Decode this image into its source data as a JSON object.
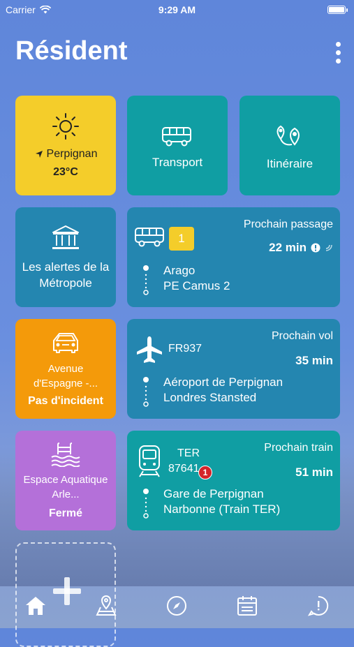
{
  "statusbar": {
    "carrier": "Carrier",
    "time": "9:29 AM"
  },
  "header": {
    "title": "Résident"
  },
  "weather": {
    "city": "Perpignan",
    "temperature": "23°C"
  },
  "transport": {
    "label": "Transport"
  },
  "itineraire": {
    "label": "Itinéraire"
  },
  "alertes": {
    "label": "Les alertes de la Métropole"
  },
  "bus": {
    "line": "1",
    "header": "Prochain passage",
    "minutes": "22 min",
    "from": "Arago",
    "to": "PE Camus 2"
  },
  "traffic": {
    "road": "Avenue d'Espagne -...",
    "status": "Pas d'incident"
  },
  "flight": {
    "code": "FR937",
    "header": "Prochain vol",
    "minutes": "35 min",
    "from": "Aéroport de Perpignan",
    "to": "Londres Stansted"
  },
  "pool": {
    "name": "Espace Aquatique Arle...",
    "status": "Fermé"
  },
  "train": {
    "type": "TER",
    "number": "87641",
    "badge": "1",
    "header": "Prochain train",
    "minutes": "51 min",
    "from": "Gare de Perpignan",
    "to": "Narbonne (Train TER)"
  },
  "tabbar": {
    "items": [
      "home-icon",
      "map-pin-icon",
      "compass-icon",
      "calendar-icon",
      "alert-icon"
    ]
  },
  "colors": {
    "yellow": "#f4cd2a",
    "teal": "#109ea3",
    "blue": "#2486b0",
    "orange": "#f49a0a",
    "purple": "#b470d9"
  }
}
